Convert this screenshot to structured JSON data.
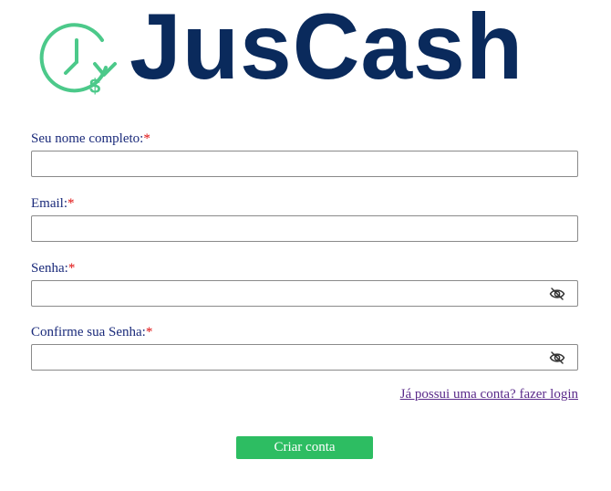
{
  "brand": {
    "name": "JusCash",
    "text_color": "#0a2a5c",
    "mark_color": "#4cc98a"
  },
  "form": {
    "fields": [
      {
        "label": "Seu nome completo:",
        "required_mark": "*",
        "value": "",
        "type": "text"
      },
      {
        "label": "Email:",
        "required_mark": "*",
        "value": "",
        "type": "email"
      },
      {
        "label": "Senha:",
        "required_mark": "*",
        "value": "",
        "type": "password",
        "icon": "eye-off-icon"
      },
      {
        "label": "Confirme sua Senha:",
        "required_mark": "*",
        "value": "",
        "type": "password",
        "icon": "eye-off-icon"
      }
    ],
    "login_link": "Já possui uma conta? fazer login",
    "submit_label": "Criar conta"
  },
  "colors": {
    "label": "#1a2a7a",
    "required": "#e01010",
    "link": "#5a2a8a",
    "button": "#2dbd62"
  }
}
